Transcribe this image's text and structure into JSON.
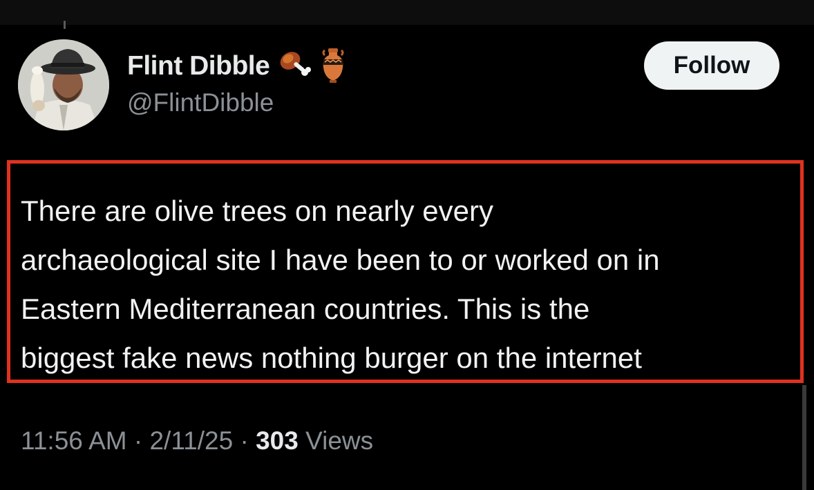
{
  "profile": {
    "display_name": "Flint Dibble",
    "handle": "@FlintDibble",
    "name_icons": [
      "meat-on-bone-icon",
      "amphora-icon"
    ]
  },
  "follow_button": {
    "label": "Follow"
  },
  "tweet": {
    "text": "There are olive trees on nearly every\narchaeological site I have been to or worked on in\nEastern Mediterranean countries. This is the\nbiggest fake news nothing burger on the internet"
  },
  "meta": {
    "time": "11:56 AM",
    "separator": " · ",
    "date": "2/11/25",
    "views_count": "303",
    "views_label": "Views"
  },
  "colors": {
    "background": "#000000",
    "primary_text": "#e7e9ea",
    "secondary_text": "#8b9196",
    "follow_bg": "#eff3f4",
    "highlight_border": "#e0321f"
  }
}
